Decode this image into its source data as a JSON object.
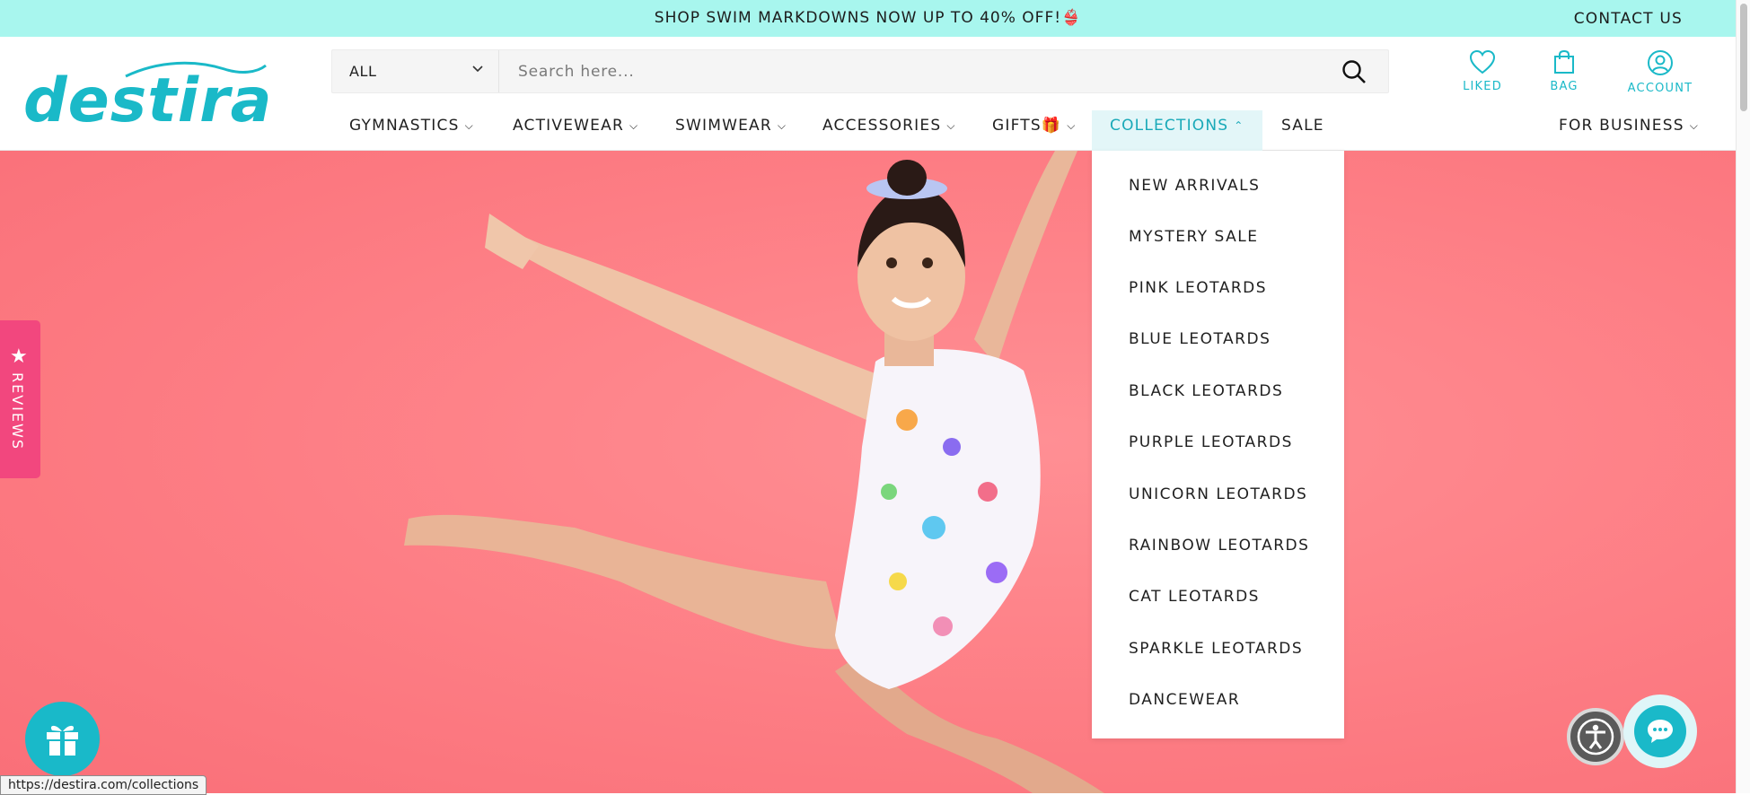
{
  "announcement": {
    "text": "SHOP SWIM MARKDOWNS NOW UP TO 40% OFF!👙",
    "contact_label": "CONTACT US"
  },
  "logo": {
    "text": "destira",
    "registered": "®"
  },
  "search": {
    "category": "ALL",
    "placeholder": "Search here..."
  },
  "header_icons": [
    {
      "label": "LIKED",
      "icon": "heart-icon"
    },
    {
      "label": "BAG",
      "icon": "bag-icon"
    },
    {
      "label": "ACCOUNT",
      "icon": "account-icon"
    }
  ],
  "nav": {
    "items": [
      {
        "label": "GYMNASTICS",
        "has_dropdown": true
      },
      {
        "label": "ACTIVEWEAR",
        "has_dropdown": true
      },
      {
        "label": "SWIMWEAR",
        "has_dropdown": true
      },
      {
        "label": "ACCESSORIES",
        "has_dropdown": true
      },
      {
        "label": "GIFTS🎁",
        "has_dropdown": true
      },
      {
        "label": "COLLECTIONS",
        "has_dropdown": true,
        "active": true
      },
      {
        "label": "SALE",
        "has_dropdown": false
      }
    ],
    "business": {
      "label": "FOR BUSINESS"
    }
  },
  "collections_menu": {
    "items": [
      "NEW ARRIVALS",
      "MYSTERY SALE",
      "PINK LEOTARDS",
      "BLUE LEOTARDS",
      "BLACK LEOTARDS",
      "PURPLE LEOTARDS",
      "UNICORN LEOTARDS",
      "RAINBOW LEOTARDS",
      "CAT LEOTARDS",
      "SPARKLE LEOTARDS",
      "DANCEWEAR"
    ]
  },
  "reviews_tab": {
    "label": "REVIEWS"
  },
  "status_url": "https://destira.com/collections",
  "colors": {
    "brand": "#1ab9c8",
    "announce_bg": "#a8f6ee",
    "hero_bg": "#fd7d84",
    "reviews_tab": "#f2477e"
  }
}
